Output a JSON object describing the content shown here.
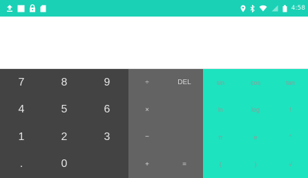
{
  "status_bar": {
    "time": "4:58",
    "colors": {
      "background": "#1ad1b5"
    },
    "left_icons": [
      "upload-icon",
      "image-icon",
      "lock-icon",
      "sd-card-icon"
    ],
    "right_icons": [
      "location-icon",
      "bluetooth-icon",
      "wifi-icon",
      "signal-icon",
      "battery-icon"
    ]
  },
  "display": {
    "expression": "",
    "result": ""
  },
  "number_pad": {
    "keys": [
      "7",
      "8",
      "9",
      "4",
      "5",
      "6",
      "1",
      "2",
      "3",
      ".",
      "0",
      ""
    ]
  },
  "operator_pad": {
    "keys": [
      "÷",
      "DEL",
      "×",
      "",
      "−",
      "",
      "+",
      "="
    ]
  },
  "advanced_pad": {
    "keys": [
      "sin",
      "cos",
      "tan",
      "ln",
      "log",
      "!",
      "π",
      "e",
      "^",
      "(",
      ")",
      "√"
    ]
  },
  "colors": {
    "number_pad_bg": "#434343",
    "operator_pad_bg": "#636363",
    "advanced_pad_bg": "#1de3bf"
  }
}
